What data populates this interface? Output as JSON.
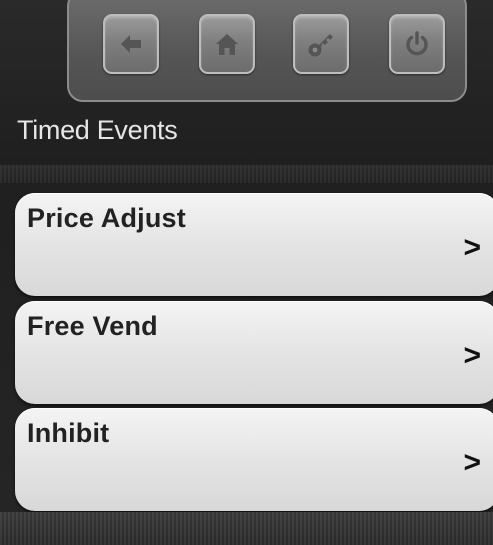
{
  "toolbar": {
    "buttons": [
      {
        "icon": "back-arrow-icon"
      },
      {
        "icon": "home-icon"
      },
      {
        "icon": "key-icon"
      },
      {
        "icon": "power-icon"
      }
    ]
  },
  "section": {
    "title": "Timed Events"
  },
  "menu": {
    "items": [
      {
        "label": "Price Adjust",
        "chevron": ">"
      },
      {
        "label": "Free Vend",
        "chevron": ">"
      },
      {
        "label": "Inhibit",
        "chevron": ">"
      }
    ]
  },
  "colors": {
    "background": "#1f1f1f",
    "row_fill": "#e8e8e8",
    "icon_color": "#5a5a5a"
  }
}
